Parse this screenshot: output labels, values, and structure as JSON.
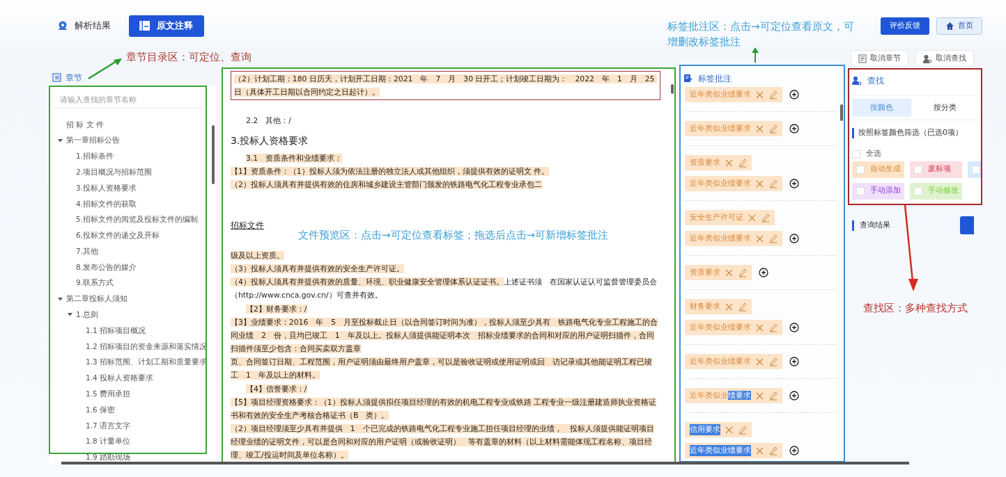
{
  "header": {
    "tabs": [
      {
        "label": "解析结果",
        "selected": false
      },
      {
        "label": "原文注释",
        "selected": true
      }
    ],
    "buttons": [
      {
        "label": "评价反馈",
        "kind": "primary"
      },
      {
        "label": "首页",
        "kind": "home"
      }
    ]
  },
  "chapters": {
    "title": "章节",
    "search": {
      "placeholder": "请输入查找的章节名称"
    },
    "tree": [
      {
        "label": "招 标 文 件"
      },
      {
        "label": "第一章招标公告",
        "expanded": true,
        "children": [
          {
            "label": "1.招标条件"
          },
          {
            "label": "2.项目概况与招标范围"
          },
          {
            "label": "3.投标人资格要求"
          },
          {
            "label": "4.招标文件的获取"
          },
          {
            "label": "5.招标文件的阅览及投标文件的编制"
          },
          {
            "label": "6.投标文件的递交及开标"
          },
          {
            "label": "7.其他"
          },
          {
            "label": "8.发布公告的媒介"
          },
          {
            "label": "9.联系方式"
          }
        ]
      },
      {
        "label": "第二章投标人须知",
        "expanded": true,
        "children": [
          {
            "label": "1.总则",
            "expanded": true,
            "children": [
              {
                "label": "1.1 招标项目概况"
              },
              {
                "label": "1.2 招标项目的资金来源和落实情况"
              },
              {
                "label": "1.3 招标范围、计划工期和质量要求"
              },
              {
                "label": "1.4 投标人资格要求"
              },
              {
                "label": "1.5 费用承担"
              },
              {
                "label": "1.6 保密"
              },
              {
                "label": "1.7 语言文字"
              },
              {
                "label": "1.8 计量单位"
              },
              {
                "label": "1.9 踏勘现场"
              }
            ]
          }
        ]
      }
    ]
  },
  "document": {
    "paragraphs": [
      {
        "kind": "boxed",
        "segments": [
          {
            "text": "（2）计划工期：180 日历天，计划开工日期：2021　年　7　月　30 日开工；计划竣工日期为：　2022　年　1　月　25 日（具体开工日期以合同约定之日起计）。",
            "highlighted": true
          }
        ]
      },
      {
        "kind": "sub",
        "segments": [
          {
            "text": "2.2　其他：/",
            "highlighted": false
          }
        ]
      },
      {
        "kind": "heading",
        "segments": [
          {
            "text": "3.投标人资格要求",
            "highlighted": false
          }
        ]
      },
      {
        "kind": "sub",
        "segments": [
          {
            "text": "3.1　资质条件和业绩要求：",
            "highlighted": true
          }
        ]
      },
      {
        "kind": "body",
        "segments": [
          {
            "text": "【1】资质条件：（1）投标人须为依法注册的独立法人或其他组织，须提供有效的证明文 件。",
            "highlighted": true
          }
        ]
      },
      {
        "kind": "body",
        "segments": [
          {
            "text": "（2）投标人须具有并提供有效的住房和城乡建设主管部门颁发的铁路电气化工程专业承包二",
            "highlighted": true
          }
        ]
      },
      {
        "kind": "page_header",
        "segments": [
          {
            "text": "招标文件",
            "highlighted": false
          }
        ]
      },
      {
        "kind": "body",
        "segments": [
          {
            "text": "级及以上资质。",
            "highlighted": true
          }
        ]
      },
      {
        "kind": "body",
        "segments": [
          {
            "text": "（3）投标人须具有并提供有效的安全生产许可证。",
            "highlighted": true
          }
        ]
      },
      {
        "kind": "body",
        "segments": [
          {
            "text": "（4）投标人须具有并提供有效的质量、环境、职业健康安全管理体系认证证书。",
            "highlighted": true
          },
          {
            "text": "上述证书须　在国家认证认可监督管理委员会（http://www.cnca.gov.cn/）可查并有效。",
            "highlighted": false
          }
        ]
      },
      {
        "kind": "sub",
        "segments": [
          {
            "text": "【2】财务要求：/",
            "highlighted": true
          }
        ]
      },
      {
        "kind": "body",
        "segments": [
          {
            "text": "【3】业绩要求：2016　年　5　月至投标截止日（以合同签订时间为准），投标人须至少具有　铁路电气化专业工程施工的合同业绩　2　份，且均已竣工　1　年及以上。投标人须提供能证明本次　招标业绩要求的合同和对应的用户证明扫描件，合同扫描件须至少包含：合同买卖双方盖章",
            "highlighted": true
          }
        ]
      },
      {
        "kind": "body",
        "segments": [
          {
            "text": "页、合同签订日期、工程范围，用户证明须由最终用户盖章，可以是验收证明或使用证明或回　访记录或其他能证明工程已竣工　1　年及以上的材料。",
            "highlighted": true
          }
        ]
      },
      {
        "kind": "sub",
        "segments": [
          {
            "text": "【4】信誉要求：/",
            "highlighted": true
          }
        ]
      },
      {
        "kind": "body",
        "segments": [
          {
            "text": "【5】项目经理资格要求：（1）投标人须提供拟任项目经理的有效的机电工程专业或铁路 工程专业一级注册建造师执业资格证书和有效的安全生产考核合格证书（B　类）。",
            "highlighted": true
          }
        ]
      },
      {
        "kind": "body",
        "segments": [
          {
            "text": "（2）项目经理须至少具有并提供　1　个已完成的铁路电气化工程专业施工担任项目经理的业绩，　投标人须提供能证明项目经理业绩的证明文件，可以是合同和对应的用户证明（或验收证明）　等有盖章的材料（以上材料需能体现工程名称、项目经理、竣工/投运时间及单位名称）。",
            "highlighted": true
          }
        ]
      }
    ]
  },
  "tags_panel": {
    "title": "标签批注",
    "groups": [
      {
        "tags": [
          {
            "label": "近年类似业绩要求",
            "selected": false
          }
        ]
      },
      {
        "tags": [
          {
            "label": "近年类似业绩要求",
            "selected": false
          }
        ]
      },
      {
        "tags": [
          {
            "label": "资质要求",
            "selected": false
          },
          {
            "label": "近年类似业绩要求",
            "selected": false
          }
        ]
      },
      {
        "tags": [
          {
            "label": "安全生产许可证",
            "selected": false
          },
          {
            "label": "近年类似业绩要求",
            "selected": false
          }
        ]
      },
      {
        "tags": [
          {
            "label": "资质要求",
            "selected": false
          }
        ]
      },
      {
        "tags": [
          {
            "label": "财务要求",
            "selected": false
          },
          {
            "label": "近年类似业绩要求",
            "selected": false
          }
        ]
      },
      {
        "tags": [
          {
            "label": "近年类似业绩要求",
            "selected": false
          }
        ]
      },
      {
        "tags": [
          {
            "parts": [
              {
                "text": "近年类似业",
                "selected": false
              },
              {
                "text": "绩要求",
                "selected": true
              }
            ]
          }
        ]
      },
      {
        "tags": [
          {
            "label": "信用要求",
            "selected": true
          },
          {
            "label": "近年类似业绩要求",
            "selected": true
          }
        ]
      }
    ]
  },
  "search_panel": {
    "actions": [
      {
        "label": "取消章节"
      },
      {
        "label": "取消查找"
      }
    ],
    "title": "查找",
    "tabs": [
      {
        "label": "按颜色",
        "selected": true
      },
      {
        "label": "按分类",
        "selected": false
      }
    ],
    "filter_title": "按照标签颜色筛选（已选0项）",
    "select_all": {
      "label": "全选",
      "checked": false
    },
    "filters": [
      {
        "label": "自动生成",
        "color": "#fde3c6",
        "checked": false
      },
      {
        "label": "废标项",
        "color": "#fbdde2",
        "checked": false
      },
      {
        "color": "#d7eafc",
        "checked": false
      },
      {
        "label": "手动添加",
        "color": "#f0e0fb",
        "checked": false
      },
      {
        "label": "手动修改",
        "color": "#dff2cf",
        "checked": false
      }
    ],
    "results_title": "查询结果"
  },
  "annotations": [
    {
      "text": "章节目录区：可定位、查询",
      "color": "#a8392b"
    },
    {
      "text": "文件预览区：点击→可定位查看标签；拖选后点击→可新增标签批注",
      "color": "#3a9fd6"
    },
    {
      "text": "标签批注区：点击→可定位查看原文，可增删改标签批注",
      "color": "#3a9fd6"
    },
    {
      "text": "查找区：多种查找方式",
      "color": "#b8312a"
    }
  ]
}
